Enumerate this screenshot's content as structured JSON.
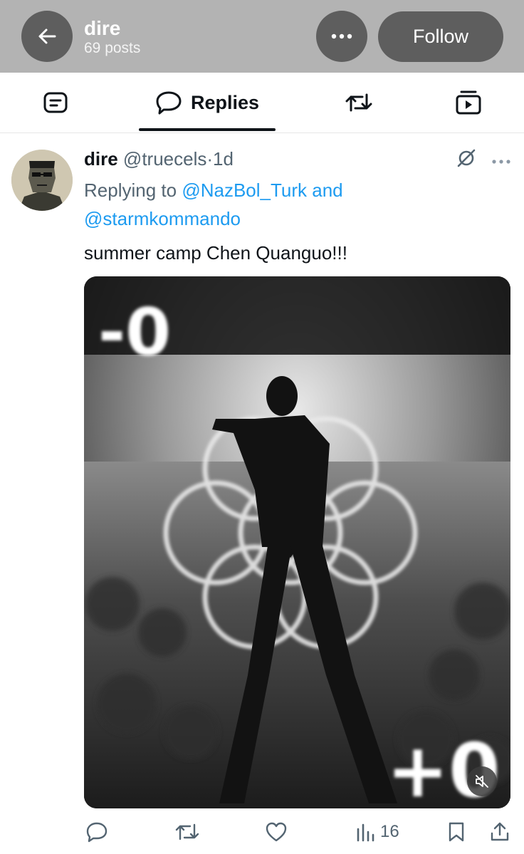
{
  "header": {
    "name": "dire",
    "post_count": "69 posts",
    "follow_label": "Follow"
  },
  "tabs": [
    {
      "name": "posts",
      "label": "",
      "icon": "posts-icon"
    },
    {
      "name": "replies",
      "label": "Replies",
      "icon": "speech-bubble-icon",
      "active": true
    },
    {
      "name": "reposts",
      "label": "",
      "icon": "repost-icon"
    },
    {
      "name": "media",
      "label": "",
      "icon": "video-icon"
    }
  ],
  "tweet": {
    "author": "dire",
    "handle": "@truecels",
    "separator": "·",
    "time": "1d",
    "replying_prefix": "Replying to",
    "mention_1": "@NazBol_Turk",
    "conjunction": "and",
    "mention_2": "@starmkommando",
    "text": "summer camp Chen Quanguo!!!",
    "media": {
      "overlay_top": "-0",
      "overlay_bottom": "+0",
      "muted": true
    },
    "stats": {
      "views": "16"
    }
  },
  "colors": {
    "topbar_bg": "#b3b3b3",
    "button_bg": "#5e5e5e",
    "link_blue": "#1d9bf0",
    "muted_text": "#536471"
  }
}
